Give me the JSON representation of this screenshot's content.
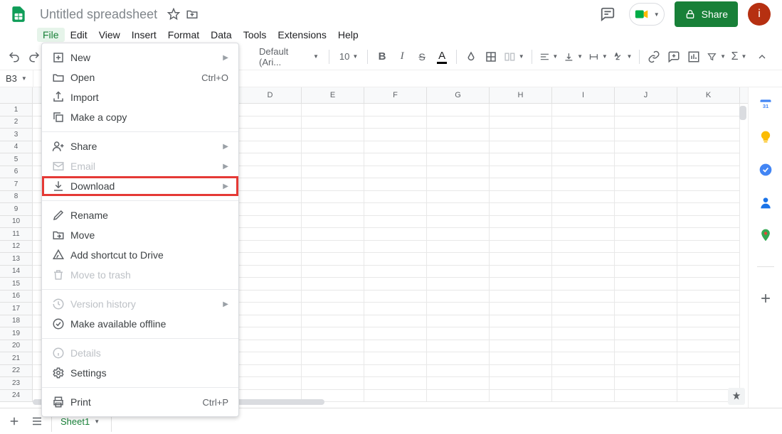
{
  "header": {
    "doc_title": "Untitled spreadsheet",
    "share_label": "Share",
    "avatar_initial": "i"
  },
  "menubar": [
    "File",
    "Edit",
    "View",
    "Insert",
    "Format",
    "Data",
    "Tools",
    "Extensions",
    "Help"
  ],
  "menubar_active_index": 0,
  "toolbar": {
    "font_name": "Default (Ari...",
    "font_size": "10"
  },
  "namebox": "B3",
  "columns": [
    "D",
    "E",
    "F",
    "G",
    "H",
    "I",
    "J",
    "K"
  ],
  "row_count": 24,
  "sheet_tab": {
    "name": "Sheet1"
  },
  "file_menu": {
    "sections": [
      [
        {
          "icon": "plus-box-icon",
          "label": "New",
          "sub": true
        },
        {
          "icon": "folder-open-icon",
          "label": "Open",
          "shortcut": "Ctrl+O"
        },
        {
          "icon": "import-icon",
          "label": "Import"
        },
        {
          "icon": "copy-icon",
          "label": "Make a copy"
        }
      ],
      [
        {
          "icon": "person-plus-icon",
          "label": "Share",
          "sub": true
        },
        {
          "icon": "mail-icon",
          "label": "Email",
          "sub": true,
          "disabled": true
        },
        {
          "icon": "download-icon",
          "label": "Download",
          "sub": true,
          "highlight": true
        }
      ],
      [
        {
          "icon": "pencil-icon",
          "label": "Rename"
        },
        {
          "icon": "drive-move-icon",
          "label": "Move"
        },
        {
          "icon": "drive-shortcut-icon",
          "label": "Add shortcut to Drive"
        },
        {
          "icon": "trash-icon",
          "label": "Move to trash",
          "disabled": true
        }
      ],
      [
        {
          "icon": "history-icon",
          "label": "Version history",
          "sub": true,
          "disabled": true
        },
        {
          "icon": "offline-icon",
          "label": "Make available offline"
        }
      ],
      [
        {
          "icon": "info-icon",
          "label": "Details",
          "disabled": true
        },
        {
          "icon": "gear-icon",
          "label": "Settings"
        }
      ],
      [
        {
          "icon": "print-icon",
          "label": "Print",
          "shortcut": "Ctrl+P"
        }
      ]
    ]
  }
}
